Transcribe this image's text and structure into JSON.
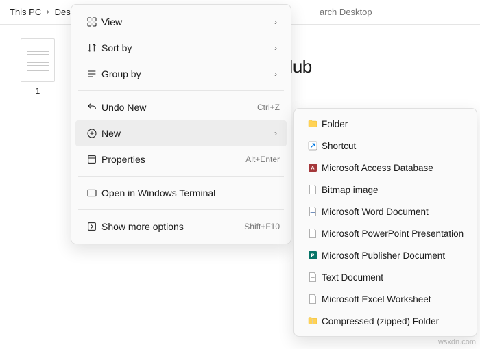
{
  "breadcrumb": {
    "root": "This PC",
    "current": "Desk"
  },
  "search": {
    "placeholder": "arch Desktop"
  },
  "file": {
    "name": "1"
  },
  "watermark": {
    "text": "TheWindowsClub"
  },
  "menu": {
    "view": "View",
    "sort": "Sort by",
    "group": "Group by",
    "undo": "Undo New",
    "undo_shortcut": "Ctrl+Z",
    "new": "New",
    "properties": "Properties",
    "properties_shortcut": "Alt+Enter",
    "terminal": "Open in Windows Terminal",
    "more": "Show more options",
    "more_shortcut": "Shift+F10"
  },
  "submenu": {
    "items": [
      {
        "label": "Folder",
        "icon": "folder"
      },
      {
        "label": "Shortcut",
        "icon": "shortcut"
      },
      {
        "label": "Microsoft Access Database",
        "icon": "access"
      },
      {
        "label": "Bitmap image",
        "icon": "bitmap"
      },
      {
        "label": "Microsoft Word Document",
        "icon": "word"
      },
      {
        "label": "Microsoft PowerPoint Presentation",
        "icon": "ppt"
      },
      {
        "label": "Microsoft Publisher Document",
        "icon": "publisher"
      },
      {
        "label": "Text Document",
        "icon": "text"
      },
      {
        "label": "Microsoft Excel Worksheet",
        "icon": "excel"
      },
      {
        "label": "Compressed (zipped) Folder",
        "icon": "zip"
      }
    ]
  },
  "footer": {
    "credit": "wsxdn.com"
  }
}
